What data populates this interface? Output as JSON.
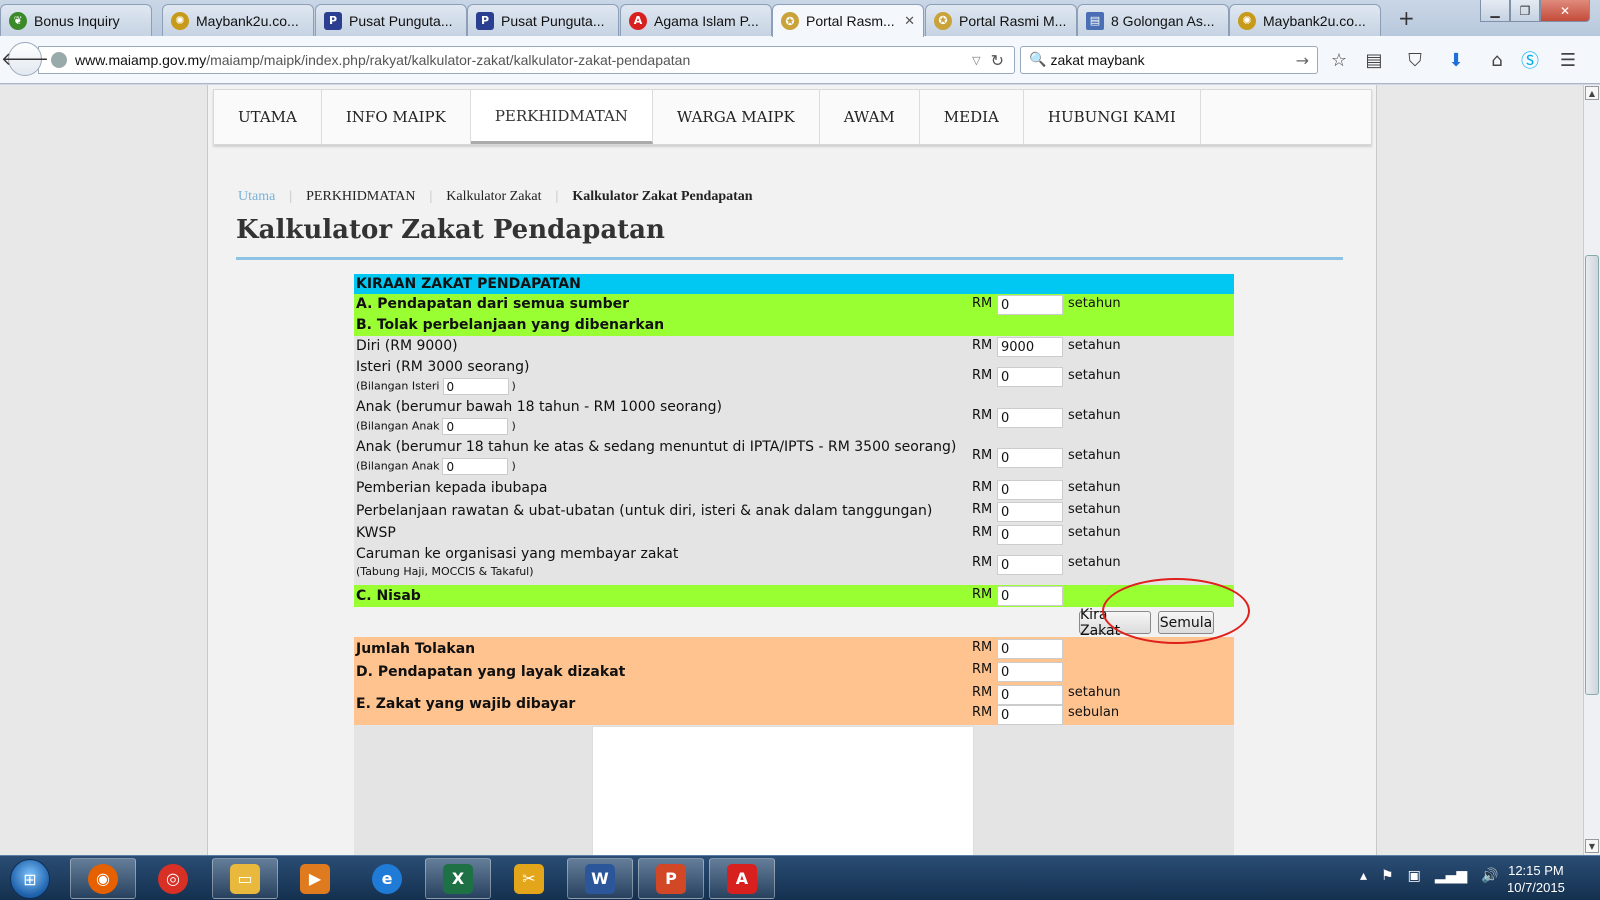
{
  "browser": {
    "tabs": [
      {
        "label": "Bonus Inquiry",
        "icon": "leaf-icon",
        "color": "#3a8a2a"
      },
      {
        "label": "Maybank2u.co...",
        "icon": "maybank-icon",
        "color": "#c79a1a"
      },
      {
        "label": "Pusat Punguta...",
        "icon": "paypal-icon",
        "color": "#2a3f8f"
      },
      {
        "label": "Pusat Punguta...",
        "icon": "paypal-icon",
        "color": "#2a3f8f"
      },
      {
        "label": "Agama Islam P...",
        "icon": "acrobat-icon",
        "color": "#d8201e"
      },
      {
        "label": "Portal Rasm...",
        "icon": "seal-icon",
        "color": "#c9a23a",
        "active": true
      },
      {
        "label": "Portal Rasmi M...",
        "icon": "seal-icon",
        "color": "#c9a23a"
      },
      {
        "label": "8 Golongan As...",
        "icon": "document-icon",
        "color": "#4a6fb5"
      },
      {
        "label": "Maybank2u.co...",
        "icon": "maybank-icon",
        "color": "#c79a1a"
      }
    ],
    "new_tab": "+",
    "url_domain": "www.maiamp.gov.my",
    "url_path": "/maiamp/maipk/index.php/rakyat/kalkulator-zakat/kalkulator-zakat-pendapatan",
    "search_value": "zakat maybank"
  },
  "menu": {
    "items": [
      "UTAMA",
      "INFO MAIPK",
      "PERKHIDMATAN",
      "WARGA MAIPK",
      "AWAM",
      "MEDIA",
      "HUBUNGI KAMI"
    ],
    "active_index": 2
  },
  "breadcrumb": [
    "Utama",
    "PERKHIDMATAN",
    "Kalkulator Zakat",
    "Kalkulator Zakat Pendapatan"
  ],
  "page_title": "Kalkulator Zakat Pendapatan",
  "calc": {
    "header": "KIRAAN ZAKAT PENDAPATAN",
    "currency": "RM",
    "per_year": "setahun",
    "per_month": "sebulan",
    "section_a": {
      "label": "A. Pendapatan dari semua sumber",
      "value": "0"
    },
    "section_b": {
      "label": "B. Tolak perbelanjaan yang dibenarkan"
    },
    "diri": {
      "label": "Diri (RM 9000)",
      "value": "9000"
    },
    "isteri": {
      "label": "Isteri (RM 3000 seorang)",
      "sub_label": "(Bilangan Isteri",
      "count": "0",
      "value": "0"
    },
    "anak_bawah": {
      "label": "Anak (berumur bawah 18 tahun - RM 1000 seorang)",
      "sub_label": "(Bilangan Anak",
      "count": "0",
      "value": "0"
    },
    "anak_atas": {
      "label": "Anak (berumur 18 tahun ke atas & sedang menuntut di IPTA/IPTS - RM 3500 seorang)",
      "sub_label": "(Bilangan Anak",
      "count": "0",
      "value": "0"
    },
    "ibubapa": {
      "label": "Pemberian kepada ibubapa",
      "value": "0"
    },
    "rawatan": {
      "label": "Perbelanjaan rawatan & ubat-ubatan (untuk diri, isteri & anak dalam tanggungan)",
      "value": "0"
    },
    "kwsp": {
      "label": "KWSP",
      "value": "0"
    },
    "caruman": {
      "label": "Caruman ke organisasi yang membayar zakat",
      "sub_label": "(Tabung Haji, MOCCIS & Takaful)",
      "value": "0"
    },
    "nisab": {
      "label": "C. Nisab",
      "value": "0"
    },
    "btn_calc": "Kira Zakat",
    "btn_reset": "Semula",
    "jumlah_tolakan": {
      "label": "Jumlah Tolakan",
      "value": "0"
    },
    "section_d": {
      "label": "D. Pendapatan yang layak dizakat",
      "value": "0"
    },
    "section_e": {
      "label": "E. Zakat yang wajib dibayar",
      "value_year": "0",
      "value_month": "0"
    },
    "close_paren": ")"
  },
  "taskbar": {
    "apps": [
      {
        "name": "firefox",
        "color": "#e66000"
      },
      {
        "name": "chrome",
        "color": "#d93025"
      },
      {
        "name": "explorer",
        "color": "#e8b93c"
      },
      {
        "name": "media",
        "color": "#e07a1f"
      },
      {
        "name": "ie",
        "color": "#1f7bd6"
      },
      {
        "name": "excel",
        "color": "#1e7145"
      },
      {
        "name": "tool",
        "color": "#e3a51a"
      },
      {
        "name": "word",
        "color": "#2b579a"
      },
      {
        "name": "powerpoint",
        "color": "#d24726"
      },
      {
        "name": "acrobat",
        "color": "#d8201e"
      }
    ],
    "time": "12:15 PM",
    "date": "10/7/2015"
  }
}
